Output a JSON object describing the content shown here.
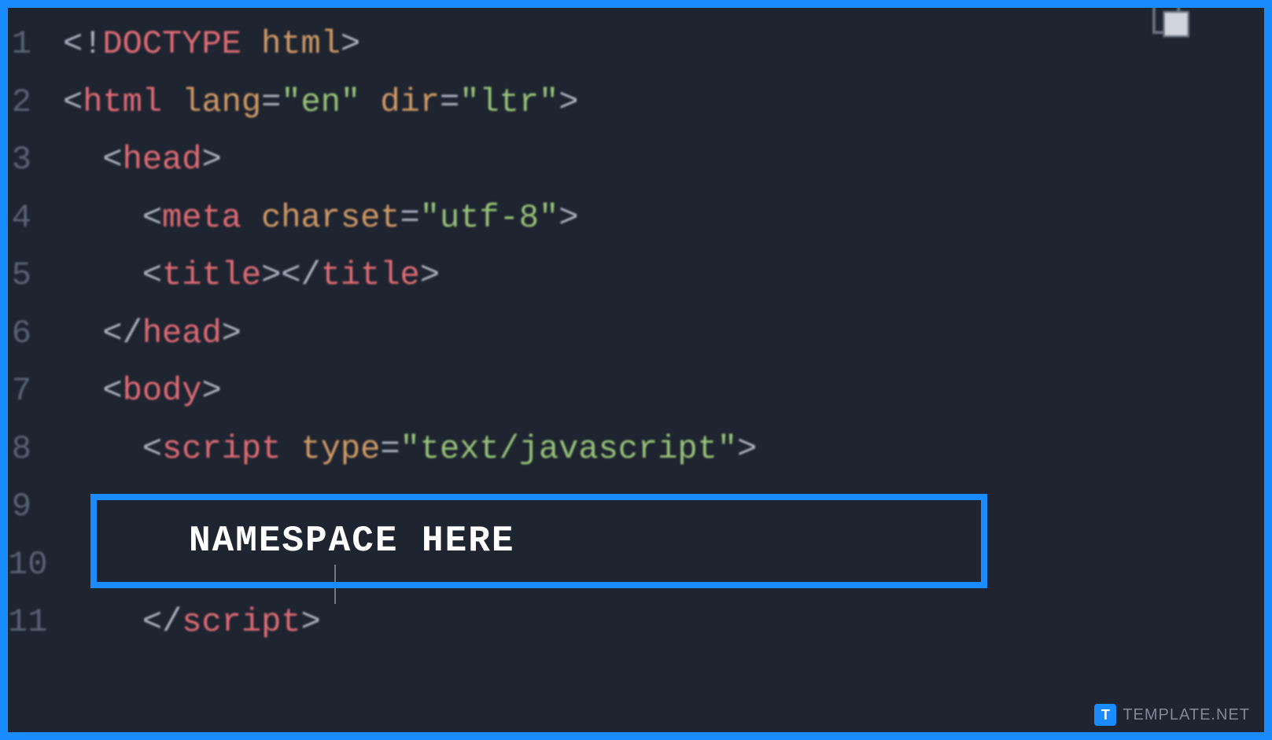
{
  "editor": {
    "lines": [
      {
        "num": "1",
        "indent": "",
        "tokens": [
          {
            "t": "bracket",
            "v": "<!"
          },
          {
            "t": "tag",
            "v": "DOCTYPE"
          },
          {
            "t": "bracket",
            "v": " "
          },
          {
            "t": "attr",
            "v": "html"
          },
          {
            "t": "bracket",
            "v": ">"
          }
        ]
      },
      {
        "num": "2",
        "indent": "",
        "tokens": [
          {
            "t": "bracket",
            "v": "<"
          },
          {
            "t": "tag",
            "v": "html"
          },
          {
            "t": "bracket",
            "v": " "
          },
          {
            "t": "attr",
            "v": "lang"
          },
          {
            "t": "punct",
            "v": "="
          },
          {
            "t": "string",
            "v": "\"en\""
          },
          {
            "t": "bracket",
            "v": " "
          },
          {
            "t": "attr",
            "v": "dir"
          },
          {
            "t": "punct",
            "v": "="
          },
          {
            "t": "string",
            "v": "\"ltr\""
          },
          {
            "t": "bracket",
            "v": ">"
          }
        ]
      },
      {
        "num": "3",
        "indent": "  ",
        "tokens": [
          {
            "t": "bracket",
            "v": "<"
          },
          {
            "t": "tag",
            "v": "head"
          },
          {
            "t": "bracket",
            "v": ">"
          }
        ]
      },
      {
        "num": "4",
        "indent": "    ",
        "tokens": [
          {
            "t": "bracket",
            "v": "<"
          },
          {
            "t": "tag",
            "v": "meta"
          },
          {
            "t": "bracket",
            "v": " "
          },
          {
            "t": "attr",
            "v": "charset"
          },
          {
            "t": "punct",
            "v": "="
          },
          {
            "t": "string",
            "v": "\"utf-8\""
          },
          {
            "t": "bracket",
            "v": ">"
          }
        ]
      },
      {
        "num": "5",
        "indent": "    ",
        "tokens": [
          {
            "t": "bracket",
            "v": "<"
          },
          {
            "t": "tag",
            "v": "title"
          },
          {
            "t": "bracket",
            "v": "></"
          },
          {
            "t": "tag",
            "v": "title"
          },
          {
            "t": "bracket",
            "v": ">"
          }
        ]
      },
      {
        "num": "6",
        "indent": "  ",
        "tokens": [
          {
            "t": "bracket",
            "v": "</"
          },
          {
            "t": "tag",
            "v": "head"
          },
          {
            "t": "bracket",
            "v": ">"
          }
        ]
      },
      {
        "num": "7",
        "indent": "  ",
        "tokens": [
          {
            "t": "bracket",
            "v": "<"
          },
          {
            "t": "tag",
            "v": "body"
          },
          {
            "t": "bracket",
            "v": ">"
          }
        ]
      },
      {
        "num": "8",
        "indent": "    ",
        "tokens": [
          {
            "t": "bracket",
            "v": "<"
          },
          {
            "t": "tag",
            "v": "script"
          },
          {
            "t": "bracket",
            "v": " "
          },
          {
            "t": "attr",
            "v": "type"
          },
          {
            "t": "punct",
            "v": "="
          },
          {
            "t": "string",
            "v": "\"text/javascript\""
          },
          {
            "t": "bracket",
            "v": ">"
          }
        ]
      },
      {
        "num": "9",
        "indent": "",
        "tokens": []
      },
      {
        "num": "10",
        "indent": "",
        "tokens": []
      },
      {
        "num": "11",
        "indent": "    ",
        "tokens": [
          {
            "t": "bracket",
            "v": "</"
          },
          {
            "t": "tag",
            "v": "script"
          },
          {
            "t": "bracket",
            "v": ">"
          }
        ]
      }
    ]
  },
  "annotation": {
    "label": "NAMESPACE HERE"
  },
  "watermark": {
    "icon_letter": "T",
    "text": "TEMPLATE.NET"
  }
}
